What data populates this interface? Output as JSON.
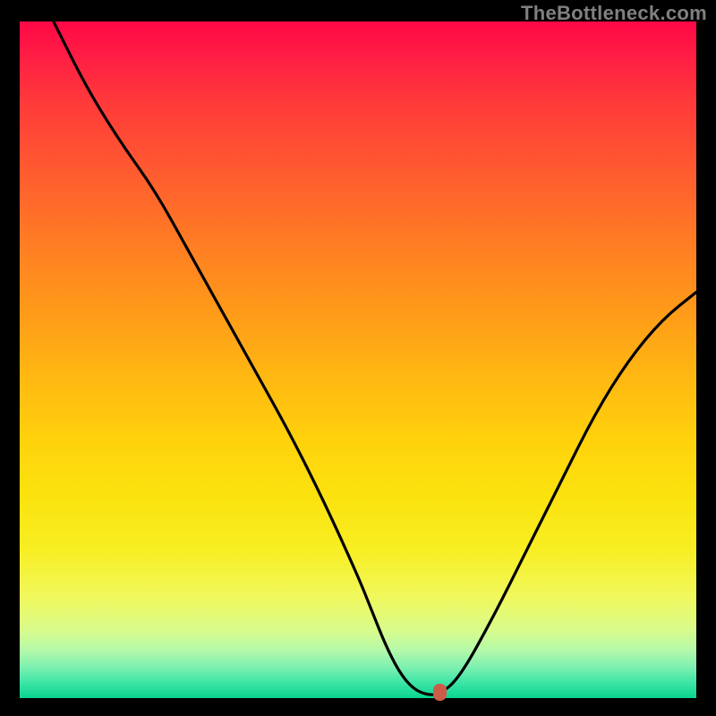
{
  "watermark": "TheBottleneck.com",
  "chart_data": {
    "type": "line",
    "title": "",
    "xlabel": "",
    "ylabel": "",
    "xlim": [
      0,
      100
    ],
    "ylim": [
      0,
      100
    ],
    "grid": false,
    "legend": false,
    "series": [
      {
        "name": "bottleneck-curve",
        "color": "#000000",
        "x": [
          5,
          10,
          15,
          20,
          25,
          30,
          35,
          40,
          45,
          50,
          52,
          54,
          56,
          58,
          60,
          62,
          65,
          70,
          75,
          80,
          85,
          90,
          95,
          100
        ],
        "values": [
          100,
          90,
          82,
          75,
          66,
          57,
          48,
          39,
          29,
          18,
          13,
          8,
          4,
          1.5,
          0.5,
          0.5,
          3,
          12,
          22,
          32,
          42,
          50,
          56,
          60
        ]
      }
    ],
    "marker": {
      "x": 62,
      "y": 0.5,
      "color": "#cc5c48"
    },
    "background_gradient": {
      "top": "#ff0846",
      "mid": "#ffd20c",
      "bottom": "#09d58f"
    }
  }
}
